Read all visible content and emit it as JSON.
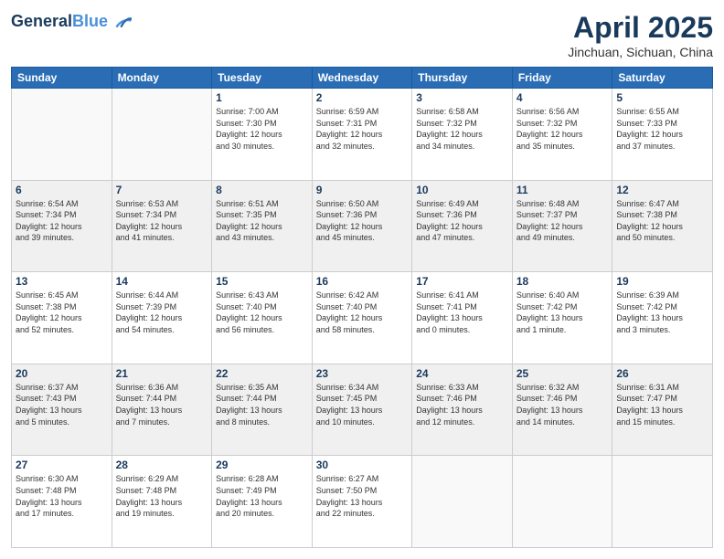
{
  "header": {
    "logo_line1": "General",
    "logo_line2": "Blue",
    "month": "April 2025",
    "location": "Jinchuan, Sichuan, China"
  },
  "weekdays": [
    "Sunday",
    "Monday",
    "Tuesday",
    "Wednesday",
    "Thursday",
    "Friday",
    "Saturday"
  ],
  "weeks": [
    [
      {
        "day": "",
        "info": ""
      },
      {
        "day": "",
        "info": ""
      },
      {
        "day": "1",
        "info": "Sunrise: 7:00 AM\nSunset: 7:30 PM\nDaylight: 12 hours\nand 30 minutes."
      },
      {
        "day": "2",
        "info": "Sunrise: 6:59 AM\nSunset: 7:31 PM\nDaylight: 12 hours\nand 32 minutes."
      },
      {
        "day": "3",
        "info": "Sunrise: 6:58 AM\nSunset: 7:32 PM\nDaylight: 12 hours\nand 34 minutes."
      },
      {
        "day": "4",
        "info": "Sunrise: 6:56 AM\nSunset: 7:32 PM\nDaylight: 12 hours\nand 35 minutes."
      },
      {
        "day": "5",
        "info": "Sunrise: 6:55 AM\nSunset: 7:33 PM\nDaylight: 12 hours\nand 37 minutes."
      }
    ],
    [
      {
        "day": "6",
        "info": "Sunrise: 6:54 AM\nSunset: 7:34 PM\nDaylight: 12 hours\nand 39 minutes."
      },
      {
        "day": "7",
        "info": "Sunrise: 6:53 AM\nSunset: 7:34 PM\nDaylight: 12 hours\nand 41 minutes."
      },
      {
        "day": "8",
        "info": "Sunrise: 6:51 AM\nSunset: 7:35 PM\nDaylight: 12 hours\nand 43 minutes."
      },
      {
        "day": "9",
        "info": "Sunrise: 6:50 AM\nSunset: 7:36 PM\nDaylight: 12 hours\nand 45 minutes."
      },
      {
        "day": "10",
        "info": "Sunrise: 6:49 AM\nSunset: 7:36 PM\nDaylight: 12 hours\nand 47 minutes."
      },
      {
        "day": "11",
        "info": "Sunrise: 6:48 AM\nSunset: 7:37 PM\nDaylight: 12 hours\nand 49 minutes."
      },
      {
        "day": "12",
        "info": "Sunrise: 6:47 AM\nSunset: 7:38 PM\nDaylight: 12 hours\nand 50 minutes."
      }
    ],
    [
      {
        "day": "13",
        "info": "Sunrise: 6:45 AM\nSunset: 7:38 PM\nDaylight: 12 hours\nand 52 minutes."
      },
      {
        "day": "14",
        "info": "Sunrise: 6:44 AM\nSunset: 7:39 PM\nDaylight: 12 hours\nand 54 minutes."
      },
      {
        "day": "15",
        "info": "Sunrise: 6:43 AM\nSunset: 7:40 PM\nDaylight: 12 hours\nand 56 minutes."
      },
      {
        "day": "16",
        "info": "Sunrise: 6:42 AM\nSunset: 7:40 PM\nDaylight: 12 hours\nand 58 minutes."
      },
      {
        "day": "17",
        "info": "Sunrise: 6:41 AM\nSunset: 7:41 PM\nDaylight: 13 hours\nand 0 minutes."
      },
      {
        "day": "18",
        "info": "Sunrise: 6:40 AM\nSunset: 7:42 PM\nDaylight: 13 hours\nand 1 minute."
      },
      {
        "day": "19",
        "info": "Sunrise: 6:39 AM\nSunset: 7:42 PM\nDaylight: 13 hours\nand 3 minutes."
      }
    ],
    [
      {
        "day": "20",
        "info": "Sunrise: 6:37 AM\nSunset: 7:43 PM\nDaylight: 13 hours\nand 5 minutes."
      },
      {
        "day": "21",
        "info": "Sunrise: 6:36 AM\nSunset: 7:44 PM\nDaylight: 13 hours\nand 7 minutes."
      },
      {
        "day": "22",
        "info": "Sunrise: 6:35 AM\nSunset: 7:44 PM\nDaylight: 13 hours\nand 8 minutes."
      },
      {
        "day": "23",
        "info": "Sunrise: 6:34 AM\nSunset: 7:45 PM\nDaylight: 13 hours\nand 10 minutes."
      },
      {
        "day": "24",
        "info": "Sunrise: 6:33 AM\nSunset: 7:46 PM\nDaylight: 13 hours\nand 12 minutes."
      },
      {
        "day": "25",
        "info": "Sunrise: 6:32 AM\nSunset: 7:46 PM\nDaylight: 13 hours\nand 14 minutes."
      },
      {
        "day": "26",
        "info": "Sunrise: 6:31 AM\nSunset: 7:47 PM\nDaylight: 13 hours\nand 15 minutes."
      }
    ],
    [
      {
        "day": "27",
        "info": "Sunrise: 6:30 AM\nSunset: 7:48 PM\nDaylight: 13 hours\nand 17 minutes."
      },
      {
        "day": "28",
        "info": "Sunrise: 6:29 AM\nSunset: 7:48 PM\nDaylight: 13 hours\nand 19 minutes."
      },
      {
        "day": "29",
        "info": "Sunrise: 6:28 AM\nSunset: 7:49 PM\nDaylight: 13 hours\nand 20 minutes."
      },
      {
        "day": "30",
        "info": "Sunrise: 6:27 AM\nSunset: 7:50 PM\nDaylight: 13 hours\nand 22 minutes."
      },
      {
        "day": "",
        "info": ""
      },
      {
        "day": "",
        "info": ""
      },
      {
        "day": "",
        "info": ""
      }
    ]
  ]
}
